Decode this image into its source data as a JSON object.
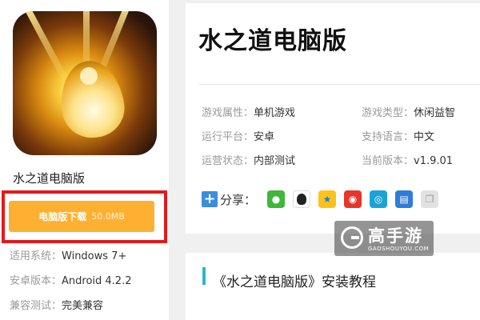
{
  "app": {
    "icon_name": "game-app-icon",
    "title": "水之道电脑版"
  },
  "download": {
    "label": "电脑版下载",
    "size": "50.0MB",
    "button_color": "#ffb030",
    "highlight_color": "#e4191b"
  },
  "meta": [
    {
      "key": "适用系统：",
      "value": "Windows 7+"
    },
    {
      "key": "安卓版本：",
      "value": "Android 4.2.2"
    },
    {
      "key": "兼容测试：",
      "value": "完美兼容"
    }
  ],
  "page_title": "水之道电脑版",
  "attributes": [
    {
      "key": "游戏属性：",
      "value": "单机游戏"
    },
    {
      "key": "游戏类型：",
      "value": "休闲益智"
    },
    {
      "key": "运行平台：",
      "value": "安卓"
    },
    {
      "key": "支持语言：",
      "value": "中文"
    },
    {
      "key": "运营状态：",
      "value": "内部测试"
    },
    {
      "key": "当前版本：",
      "value": "v1.9.01"
    }
  ],
  "share": {
    "label": "分享：",
    "icons": [
      "wechat-icon",
      "qq-icon",
      "qzone-icon",
      "weibo-icon",
      "tencent-weibo-icon",
      "print-icon",
      "copy-icon"
    ]
  },
  "section_title": "《水之道电脑版》安装教程",
  "watermark": {
    "brand": "高手游",
    "domain": "GAOSHOUYOU.COM"
  }
}
